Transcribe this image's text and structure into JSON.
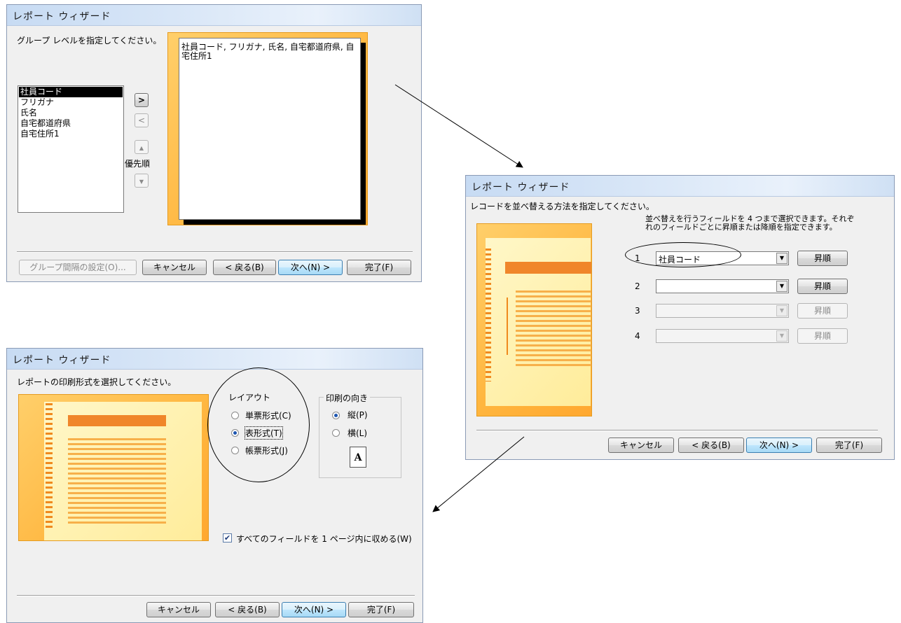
{
  "dialog1": {
    "title": "レポート ウィザード",
    "instruction": "グループ レベルを指定してください。",
    "fields": [
      "社員コード",
      "フリガナ",
      "氏名",
      "自宅都道府県",
      "自宅住所1"
    ],
    "selected_field": "社員コード",
    "add_label": ">",
    "remove_label": "<",
    "priority_label": "優先順",
    "preview_text": "社員コード, フリガナ, 氏名, 自宅都道府県, 自宅住所1",
    "buttons": {
      "grouping_options": "グループ間隔の設定(O)...",
      "cancel": "キャンセル",
      "back": "< 戻る(B)",
      "next": "次へ(N) >",
      "finish": "完了(F)"
    }
  },
  "dialog2": {
    "title": "レポート ウィザード",
    "instruction": "レコードを並べ替える方法を指定してください。",
    "hint": "並べ替えを行うフィールドを 4 つまで選択できます。それぞれのフィールドごとに昇順または降順を指定できます。",
    "sorts": [
      {
        "num": "1",
        "field": "社員コード",
        "order": "昇順",
        "enabled": true
      },
      {
        "num": "2",
        "field": "",
        "order": "昇順",
        "enabled": true
      },
      {
        "num": "3",
        "field": "",
        "order": "昇順",
        "enabled": false
      },
      {
        "num": "4",
        "field": "",
        "order": "昇順",
        "enabled": false
      }
    ],
    "buttons": {
      "cancel": "キャンセル",
      "back": "< 戻る(B)",
      "next": "次へ(N) >",
      "finish": "完了(F)"
    }
  },
  "dialog3": {
    "title": "レポート ウィザード",
    "instruction": "レポートの印刷形式を選択してください。",
    "layout_label": "レイアウト",
    "layouts": [
      {
        "label": "単票形式(C)",
        "selected": false
      },
      {
        "label": "表形式(T)",
        "selected": true
      },
      {
        "label": "帳票形式(J)",
        "selected": false
      }
    ],
    "orientation_label": "印刷の向き",
    "orientations": [
      {
        "label": "縦(P)",
        "selected": true
      },
      {
        "label": "横(L)",
        "selected": false
      }
    ],
    "fit_checkbox": "すべてのフィールドを 1 ページ内に収める(W)",
    "fit_checked": true,
    "buttons": {
      "cancel": "キャンセル",
      "back": "< 戻る(B)",
      "next": "次へ(N) >",
      "finish": "完了(F)"
    }
  }
}
